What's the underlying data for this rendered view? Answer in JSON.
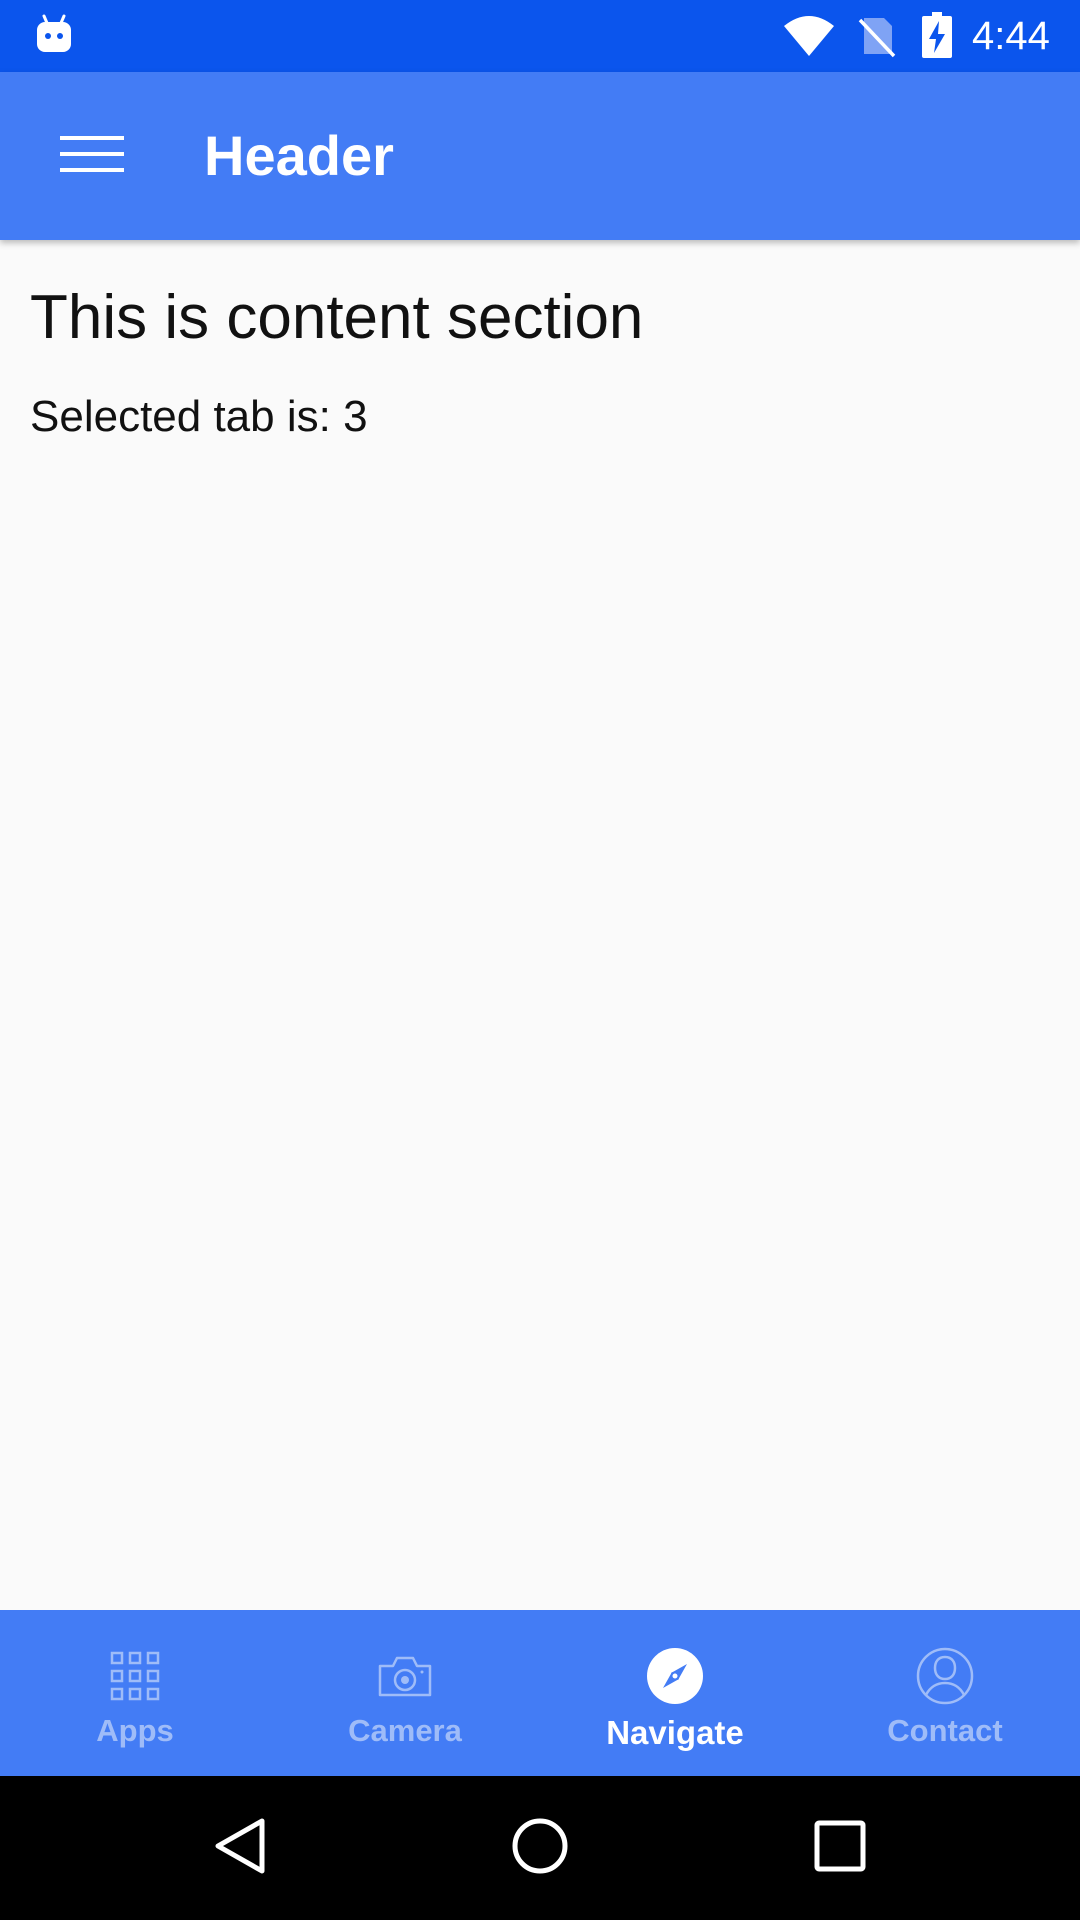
{
  "status_bar": {
    "time": "4:44",
    "icons": [
      "android-notification-icon",
      "wifi-icon",
      "no-sim-icon",
      "battery-charging-icon"
    ]
  },
  "app_bar": {
    "title": "Header",
    "menu_icon": "hamburger-menu-icon"
  },
  "content": {
    "title": "This is content section",
    "selected_tab_text": "Selected tab is: 3"
  },
  "tabs": [
    {
      "label": "Apps",
      "icon": "apps-grid-icon",
      "active": false
    },
    {
      "label": "Camera",
      "icon": "camera-icon",
      "active": false
    },
    {
      "label": "Navigate",
      "icon": "compass-icon",
      "active": true
    },
    {
      "label": "Contact",
      "icon": "contact-icon",
      "active": false
    }
  ],
  "navigation_bar": {
    "icons": [
      "back-icon",
      "home-icon",
      "recents-icon"
    ]
  },
  "colors": {
    "status_bar": "#0b55ed",
    "app_bar": "#437cf5",
    "tab_bar": "#437cf5",
    "inactive_tab": "#9fbcf8",
    "active_tab": "#ffffff",
    "background": "#fafafa",
    "nav_bar": "#000000"
  }
}
